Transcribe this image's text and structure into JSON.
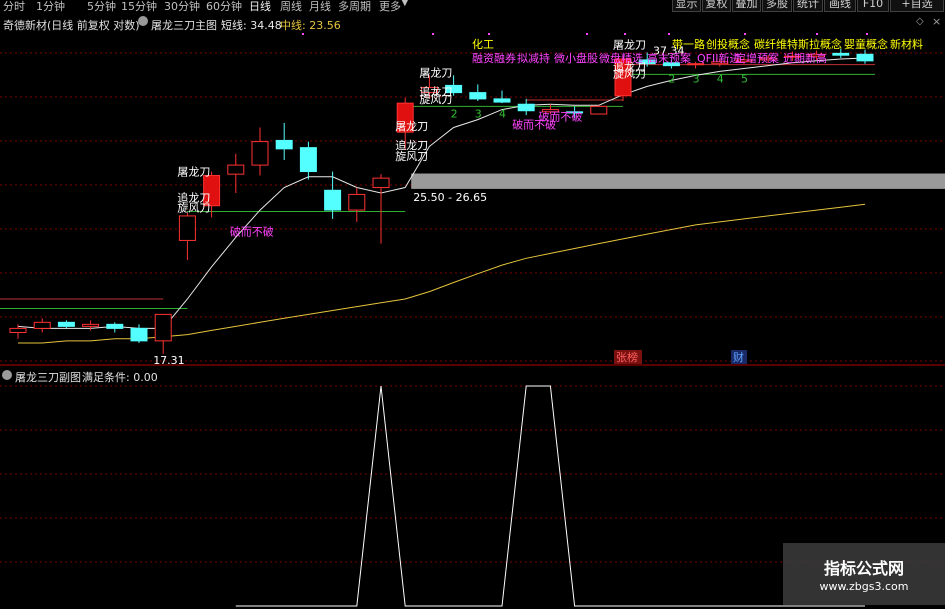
{
  "toolbar": {
    "periods": [
      "分时",
      "1分钟",
      "5分钟",
      "15分钟",
      "30分钟",
      "60分钟",
      "日线",
      "周线",
      "月线",
      "多周期",
      "更多"
    ],
    "active_period": "日线",
    "right_buttons": [
      "显示",
      "复权",
      "叠加",
      "多股",
      "统计",
      "画线",
      "F10",
      "+自选"
    ]
  },
  "main_header": {
    "stock": "奇德新材(日线 前复权 对数)",
    "indicator": "屠龙三刀主图",
    "short_label": "短线: 34.48",
    "mid_label": "中线: 23.56"
  },
  "sub_header": {
    "indicator": "屠龙三刀副图",
    "condition": "满足条件: 0.00"
  },
  "colors": {
    "up": "#ff3232",
    "down": "#54ffff",
    "short_line": "#e8e8e8",
    "mid_line": "#e4c43c",
    "signal_text": "#ff44ff",
    "concept_text": "#ffff00",
    "green_line": "#30b030",
    "grid_red": "#800000"
  },
  "chart_data": {
    "type": "candlestick",
    "ohlc": [
      [
        16.9,
        17.3,
        16.6,
        17.1
      ],
      [
        17.1,
        17.6,
        16.9,
        17.4
      ],
      [
        17.4,
        17.5,
        17.1,
        17.2
      ],
      [
        17.2,
        17.5,
        17.0,
        17.3
      ],
      [
        17.3,
        17.4,
        16.9,
        17.1
      ],
      [
        17.1,
        17.3,
        16.4,
        16.5
      ],
      [
        16.5,
        17.6,
        15.9,
        17.8
      ],
      [
        22.0,
        23.8,
        20.8,
        23.6
      ],
      [
        24.3,
        26.8,
        23.5,
        26.5
      ],
      [
        26.6,
        28.2,
        25.2,
        27.3
      ],
      [
        27.3,
        30.4,
        26.5,
        29.2
      ],
      [
        29.3,
        30.8,
        27.7,
        28.6
      ],
      [
        28.7,
        29.2,
        26.2,
        26.8
      ],
      [
        25.4,
        26.8,
        23.4,
        24.0
      ],
      [
        24.0,
        25.6,
        23.2,
        25.1
      ],
      [
        25.6,
        26.6,
        21.8,
        26.3
      ],
      [
        30.0,
        33.1,
        28.5,
        32.6
      ],
      [
        33.6,
        35.3,
        33.0,
        34.1
      ],
      [
        34.3,
        35.3,
        33.3,
        33.6
      ],
      [
        33.6,
        34.4,
        32.8,
        33.0
      ],
      [
        33.0,
        33.8,
        32.6,
        32.7
      ],
      [
        32.5,
        33.0,
        31.5,
        31.9
      ],
      [
        31.8,
        32.5,
        31.6,
        32.0
      ],
      [
        31.8,
        32.3,
        31.2,
        31.7
      ],
      [
        31.6,
        32.4,
        31.6,
        32.3
      ],
      [
        33.3,
        37.3,
        32.8,
        37.0
      ],
      [
        36.9,
        37.7,
        36.2,
        36.5
      ],
      [
        36.6,
        36.9,
        36.0,
        36.3
      ],
      [
        36.4,
        36.7,
        36.0,
        36.5
      ],
      [
        36.5,
        37.0,
        36.2,
        36.7
      ],
      [
        36.7,
        37.2,
        36.5,
        36.9
      ],
      [
        36.9,
        37.4,
        36.6,
        37.1
      ],
      [
        37.2,
        37.8,
        36.8,
        37.3
      ],
      [
        37.3,
        37.9,
        36.9,
        37.5
      ],
      [
        37.6,
        38.1,
        37.1,
        37.4
      ],
      [
        37.5,
        38.0,
        36.5,
        36.8
      ]
    ],
    "short_ma": [
      17.2,
      17.1,
      17.1,
      17.1,
      17.2,
      17.1,
      17.1,
      18.6,
      20.4,
      22.2,
      24.0,
      25.6,
      26.4,
      26.4,
      25.6,
      25.2,
      25.6,
      28.8,
      30.4,
      31.1,
      32.0,
      32.4,
      32.5,
      32.4,
      32.4,
      33.4,
      34.2,
      34.8,
      35.3,
      35.7,
      36.0,
      36.3,
      36.6,
      36.8,
      37.0,
      37.1
    ],
    "mid_ma": [
      16.4,
      16.4,
      16.5,
      16.5,
      16.6,
      16.6,
      16.7,
      16.8,
      17.0,
      17.2,
      17.4,
      17.6,
      17.8,
      18.0,
      18.2,
      18.4,
      18.6,
      19.0,
      19.5,
      20.0,
      20.5,
      20.9,
      21.2,
      21.5,
      21.8,
      22.1,
      22.4,
      22.7,
      23.0,
      23.2,
      23.4,
      23.6,
      23.8,
      24.0,
      24.2,
      24.4
    ],
    "y_range": [
      15.8,
      40.2
    ],
    "price_labels": [
      "37.34",
      "25.50 - 26.65",
      "17.31"
    ],
    "signals": {
      "tulong": "屠龙刀",
      "zhuilong": "追龙刀",
      "xuanfeng": "旋风刀",
      "break_desc": "破而不破",
      "counts": [
        "2",
        "3",
        "4",
        "5"
      ]
    },
    "concepts_line1": [
      "化工",
      "带一路",
      "创投概念",
      "碳纤维",
      "特斯拉概念",
      "婴童概念",
      "新材料"
    ],
    "concepts_line2": [
      "融资融券",
      "拟减持",
      "微小盘股",
      "微盘精选",
      "高末预案",
      "QFII新进",
      "定增预案",
      "近期新高"
    ],
    "event_labels": [
      "张榜",
      "财"
    ],
    "sub_signal": [
      0,
      0,
      0,
      0,
      0,
      0,
      0,
      0,
      0,
      0,
      0,
      0,
      0,
      0,
      0,
      1,
      0,
      0,
      0,
      0,
      0,
      0,
      0,
      0,
      0,
      0,
      0,
      0,
      0,
      0,
      0,
      0,
      0,
      0,
      0,
      0
    ],
    "sub_signal_flat": [
      0,
      0,
      0,
      0,
      0,
      0,
      0,
      0,
      0,
      0,
      0,
      0,
      0,
      0,
      0,
      0,
      0,
      0,
      0,
      0,
      0,
      1,
      1,
      0,
      0,
      0,
      0,
      0,
      0,
      0,
      0,
      0,
      0,
      0,
      0,
      0
    ]
  },
  "watermark": {
    "title": "指标公式网",
    "url": "www.zbgs3.com"
  }
}
